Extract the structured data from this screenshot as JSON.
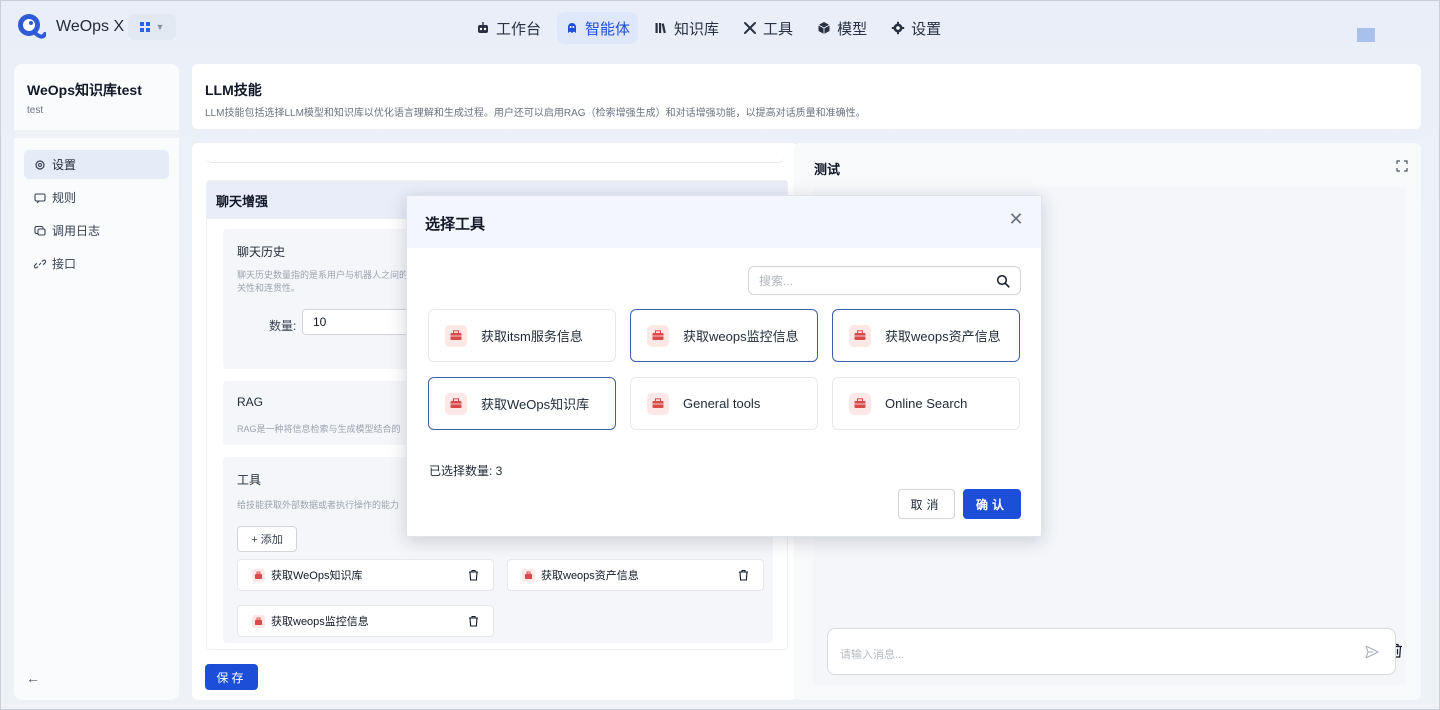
{
  "app": {
    "name": "WeOps X"
  },
  "nav": {
    "items": [
      {
        "label": "工作台",
        "icon": "robot-icon"
      },
      {
        "label": "智能体",
        "icon": "agent-icon",
        "active": true
      },
      {
        "label": "知识库",
        "icon": "library-icon"
      },
      {
        "label": "工具",
        "icon": "tools-icon"
      },
      {
        "label": "模型",
        "icon": "cube-icon"
      },
      {
        "label": "设置",
        "icon": "gear-icon"
      }
    ]
  },
  "sidebar": {
    "title": "WeOps知识库test",
    "subtitle": "test",
    "items": [
      {
        "label": "设置",
        "icon": "settings-icon",
        "active": true
      },
      {
        "label": "规则",
        "icon": "rules-icon"
      },
      {
        "label": "调用日志",
        "icon": "log-icon"
      },
      {
        "label": "接口",
        "icon": "link-icon"
      }
    ]
  },
  "header": {
    "title": "LLM技能",
    "description": "LLM技能包括选择LLM模型和知识库以优化语言理解和生成过程。用户还可以启用RAG（检索增强生成）和对话增强功能，以提高对话质量和准确性。"
  },
  "chat_enhance": {
    "section_title": "聊天增强",
    "history": {
      "title": "聊天历史",
      "description": "聊天历史数量指的是系用户与机器人之间的相关性和连贯性。",
      "qty_label": "数量:",
      "qty_value": "10"
    },
    "rag": {
      "title": "RAG",
      "description": "RAG是一种将信息检索与生成模型结合的"
    },
    "tools": {
      "title": "工具",
      "description": "给技能获取外部数据或者执行操作的能力",
      "add_label": "+ 添加",
      "selected": [
        {
          "label": "获取WeOps知识库"
        },
        {
          "label": "获取weops资产信息"
        },
        {
          "label": "获取weops监控信息"
        }
      ]
    }
  },
  "save_label": "保存",
  "test_panel": {
    "title": "测试",
    "input_placeholder": "请输入消息..."
  },
  "modal": {
    "title": "选择工具",
    "search_placeholder": "搜索...",
    "tools": [
      {
        "label": "获取itsm服务信息",
        "selected": false
      },
      {
        "label": "获取weops监控信息",
        "selected": true
      },
      {
        "label": "获取weops资产信息",
        "selected": true
      },
      {
        "label": "获取WeOps知识库",
        "selected": true
      },
      {
        "label": "General tools",
        "selected": false
      },
      {
        "label": "Online Search",
        "selected": false
      }
    ],
    "selected_count_text": "已选择数量: 3",
    "cancel_label": "取消",
    "confirm_label": "确认"
  },
  "colors": {
    "primary": "#1d4ed8",
    "selected_border": "#3b5fa8",
    "tool_icon_bg": "#fde7e7",
    "tool_icon": "#d94b4b"
  }
}
